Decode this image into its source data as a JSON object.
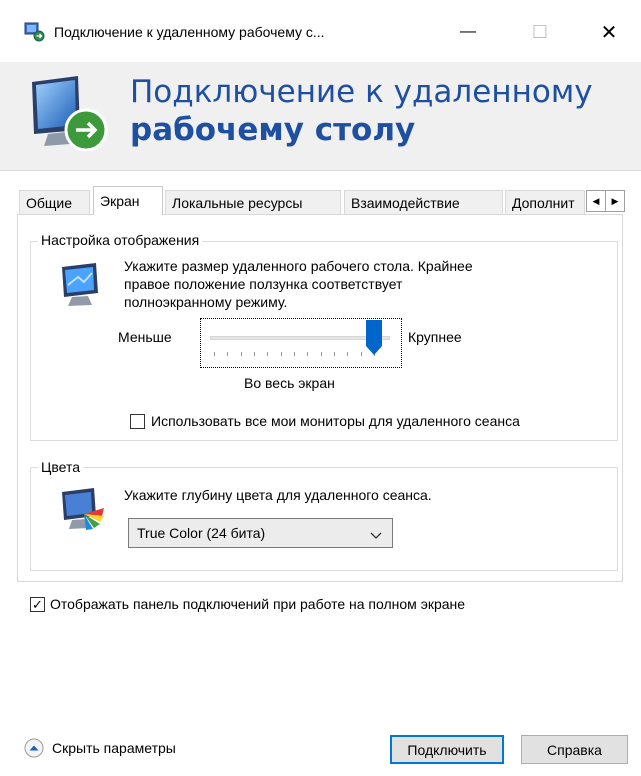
{
  "window": {
    "title": "Подключение к удаленному рабочему с...",
    "minimize_glyph": "—",
    "maximize_glyph": "☐",
    "close_glyph": "✕"
  },
  "banner": {
    "line1": "Подключение к удаленному",
    "line2": "рабочему столу"
  },
  "tabs": [
    {
      "label": "Общие",
      "active": false
    },
    {
      "label": "Экран",
      "active": true
    },
    {
      "label": "Локальные ресурсы",
      "active": false
    },
    {
      "label": "Взаимодействие",
      "active": false
    },
    {
      "label": "Дополнит",
      "active": false
    }
  ],
  "tab_scroll": {
    "left": "◀",
    "right": "▶"
  },
  "display_group": {
    "label": "Настройка отображения",
    "description_line1": "Укажите размер удаленного рабочего стола. Крайнее",
    "description_line2": "правое положение ползунка соответствует",
    "description_line3": "полноэкранному режиму.",
    "slider_min_label": "Меньше",
    "slider_max_label": "Крупнее",
    "slider_value": 1.0,
    "slider_value_text": "Во весь экран",
    "all_monitors_label": "Использовать все мои мониторы для удаленного сеанса",
    "all_monitors_checked": false
  },
  "colors_group": {
    "label": "Цвета",
    "description": "Укажите глубину цвета для удаленного сеанса.",
    "selected_depth": "True Color (24 бита)"
  },
  "connection_bar": {
    "label": "Отображать панель подключений при работе на полном экране",
    "checked": true,
    "check_glyph": "✓"
  },
  "footer": {
    "hide_options_label": "Скрыть параметры",
    "connect_label": "Подключить",
    "help_label": "Справка"
  },
  "colors": {
    "banner_text": "#1e4fa0",
    "focus_border": "#0078d7",
    "slider_thumb": "#0066cc"
  }
}
